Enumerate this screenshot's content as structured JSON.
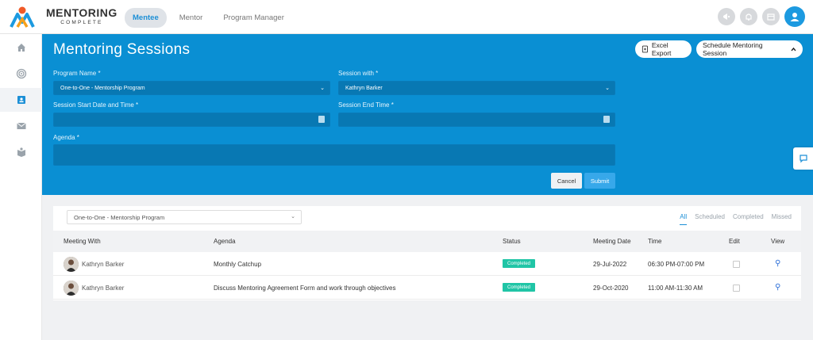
{
  "brand": {
    "line1": "MENTORING",
    "line2": "COMPLETE"
  },
  "nav": {
    "tabs": [
      {
        "label": "Mentee"
      },
      {
        "label": "Mentor"
      },
      {
        "label": "Program Manager"
      }
    ]
  },
  "top_icons": [
    "megaphone-icon",
    "bell-icon",
    "calendar-icon",
    "user-avatar-icon"
  ],
  "sidebar": {
    "items": [
      "home-icon",
      "target-icon",
      "contacts-icon",
      "mail-icon",
      "book-icon"
    ],
    "active_index": 2
  },
  "page": {
    "title": "Mentoring Sessions",
    "excel_export": "Excel Export",
    "schedule_button": "Schedule Mentoring Session"
  },
  "form": {
    "program_label": "Program Name *",
    "program_value": "One-to-One - Mentorship Program",
    "session_with_label": "Session with *",
    "session_with_value": "Kathryn Barker",
    "start_label": "Session Start Date and Time *",
    "start_value": "",
    "end_label": "Session End Time *",
    "end_value": "",
    "agenda_label": "Agenda *",
    "agenda_value": "",
    "cancel": "Cancel",
    "submit": "Submit"
  },
  "list": {
    "program_filter": "One-to-One - Mentorship Program",
    "filters": [
      "All",
      "Scheduled",
      "Completed",
      "Missed"
    ],
    "active_filter": "All",
    "columns": [
      "Meeting With",
      "Agenda",
      "Status",
      "Meeting Date",
      "Time",
      "Edit",
      "View"
    ],
    "rows": [
      {
        "with": "Kathryn Barker",
        "agenda": "Monthly Catchup",
        "status": "Completed",
        "date": "29-Jul-2022",
        "time": "06:30 PM-07:00 PM"
      },
      {
        "with": "Kathryn Barker",
        "agenda": "Discuss Mentoring Agreement Form and work through objectives",
        "status": "Completed",
        "date": "29-Oct-2020",
        "time": "11:00 AM-11:30 AM"
      }
    ]
  },
  "colors": {
    "primary": "#0a8fd3",
    "field": "#0878b3",
    "badge": "#20c5a6",
    "submit": "#37a8ea"
  }
}
